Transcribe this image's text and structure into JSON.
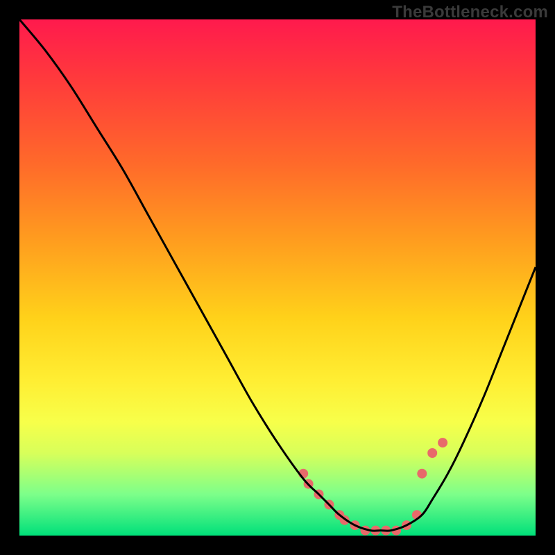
{
  "watermark": "TheBottleneck.com",
  "chart_data": {
    "type": "line",
    "title": "",
    "xlabel": "",
    "ylabel": "",
    "xlim": [
      0,
      100
    ],
    "ylim": [
      0,
      100
    ],
    "grid": false,
    "legend": false,
    "background_gradient": {
      "direction": "vertical",
      "stops": [
        {
          "pos": 0.0,
          "color": "#ff1a4d"
        },
        {
          "pos": 0.12,
          "color": "#ff3b3b"
        },
        {
          "pos": 0.28,
          "color": "#ff6a2a"
        },
        {
          "pos": 0.42,
          "color": "#ff9a1f"
        },
        {
          "pos": 0.58,
          "color": "#ffd21a"
        },
        {
          "pos": 0.7,
          "color": "#ffee33"
        },
        {
          "pos": 0.78,
          "color": "#f7ff4a"
        },
        {
          "pos": 0.84,
          "color": "#d8ff5a"
        },
        {
          "pos": 0.92,
          "color": "#7dff8a"
        },
        {
          "pos": 1.0,
          "color": "#00e07a"
        }
      ]
    },
    "series": [
      {
        "name": "bottleneck-curve",
        "color": "#000000",
        "x": [
          0,
          5,
          10,
          15,
          20,
          25,
          30,
          35,
          40,
          45,
          50,
          55,
          58,
          60,
          62,
          65,
          68,
          70,
          72,
          75,
          78,
          80,
          83,
          86,
          90,
          94,
          98,
          100
        ],
        "y": [
          100,
          94,
          87,
          79,
          71,
          62,
          53,
          44,
          35,
          26,
          18,
          11,
          8,
          6,
          4,
          2,
          1,
          1,
          1,
          2,
          4,
          7,
          12,
          18,
          27,
          37,
          47,
          52
        ]
      }
    ],
    "markers": {
      "name": "data-points",
      "color": "#e86a6a",
      "radius_px": 7,
      "x": [
        55,
        56,
        58,
        60,
        62,
        63,
        65,
        67,
        69,
        71,
        73,
        75,
        77,
        78,
        80,
        82
      ],
      "y": [
        12,
        10,
        8,
        6,
        4,
        3,
        2,
        1,
        1,
        1,
        1,
        2,
        4,
        12,
        16,
        18
      ]
    }
  }
}
